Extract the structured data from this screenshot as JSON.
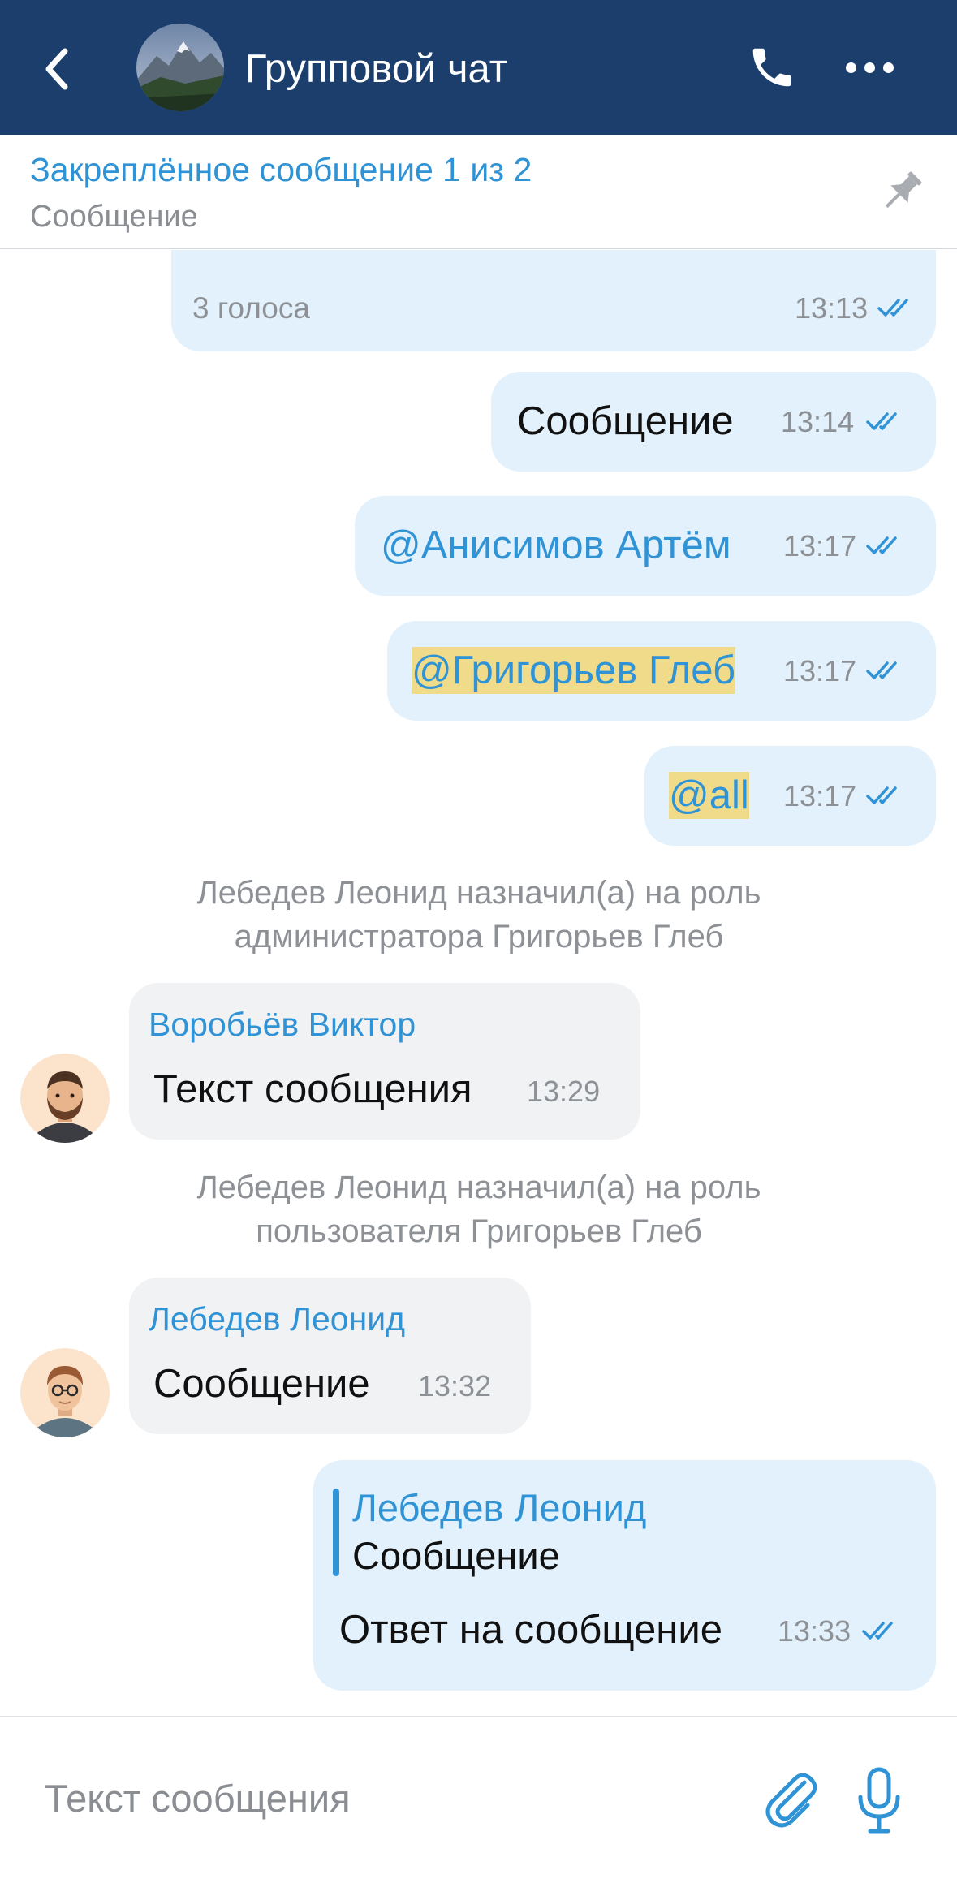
{
  "header": {
    "title": "Групповой чат",
    "back_icon": "chevron-left-icon",
    "call_icon": "phone-icon",
    "more_icon": "more-horizontal-icon"
  },
  "pinned": {
    "title": "Закреплённое сообщение 1 из 2",
    "text": "Сообщение",
    "icon": "pin-icon"
  },
  "messages": {
    "poll": {
      "votes": "3 голоса",
      "time": "13:13"
    },
    "m1": {
      "text": "Сообщение",
      "time": "13:14"
    },
    "m2": {
      "text": "@Анисимов Артём",
      "time": "13:17"
    },
    "m3": {
      "text": "@Григорьев Глеб",
      "time": "13:17"
    },
    "m4": {
      "text": "@all",
      "time": "13:17"
    },
    "sys1": {
      "line1": "Лебедев Леонид назначил(а) на роль",
      "line2": "администратора Григорьев Глеб"
    },
    "in1": {
      "sender": "Воробьёв Виктор",
      "text": "Текст сообщения",
      "time": "13:29"
    },
    "sys2": {
      "line1": "Лебедев Леонид назначил(а) на роль",
      "line2": "пользователя Григорьев Глеб"
    },
    "in2": {
      "sender": "Лебедев Леонид",
      "text": "Сообщение",
      "time": "13:32"
    },
    "reply": {
      "quoted_sender": "Лебедев Леонид",
      "quoted_text": "Сообщение",
      "text": "Ответ на сообщение",
      "time": "13:33"
    }
  },
  "input": {
    "placeholder": "Текст сообщения",
    "attach_icon": "paperclip-icon",
    "mic_icon": "microphone-icon"
  },
  "colors": {
    "header_bg": "#1b3e6c",
    "accent": "#2f93d6",
    "bubble_out": "#e2f1fb",
    "bubble_in": "#f1f2f4",
    "mention_highlight": "#f0db8a"
  }
}
